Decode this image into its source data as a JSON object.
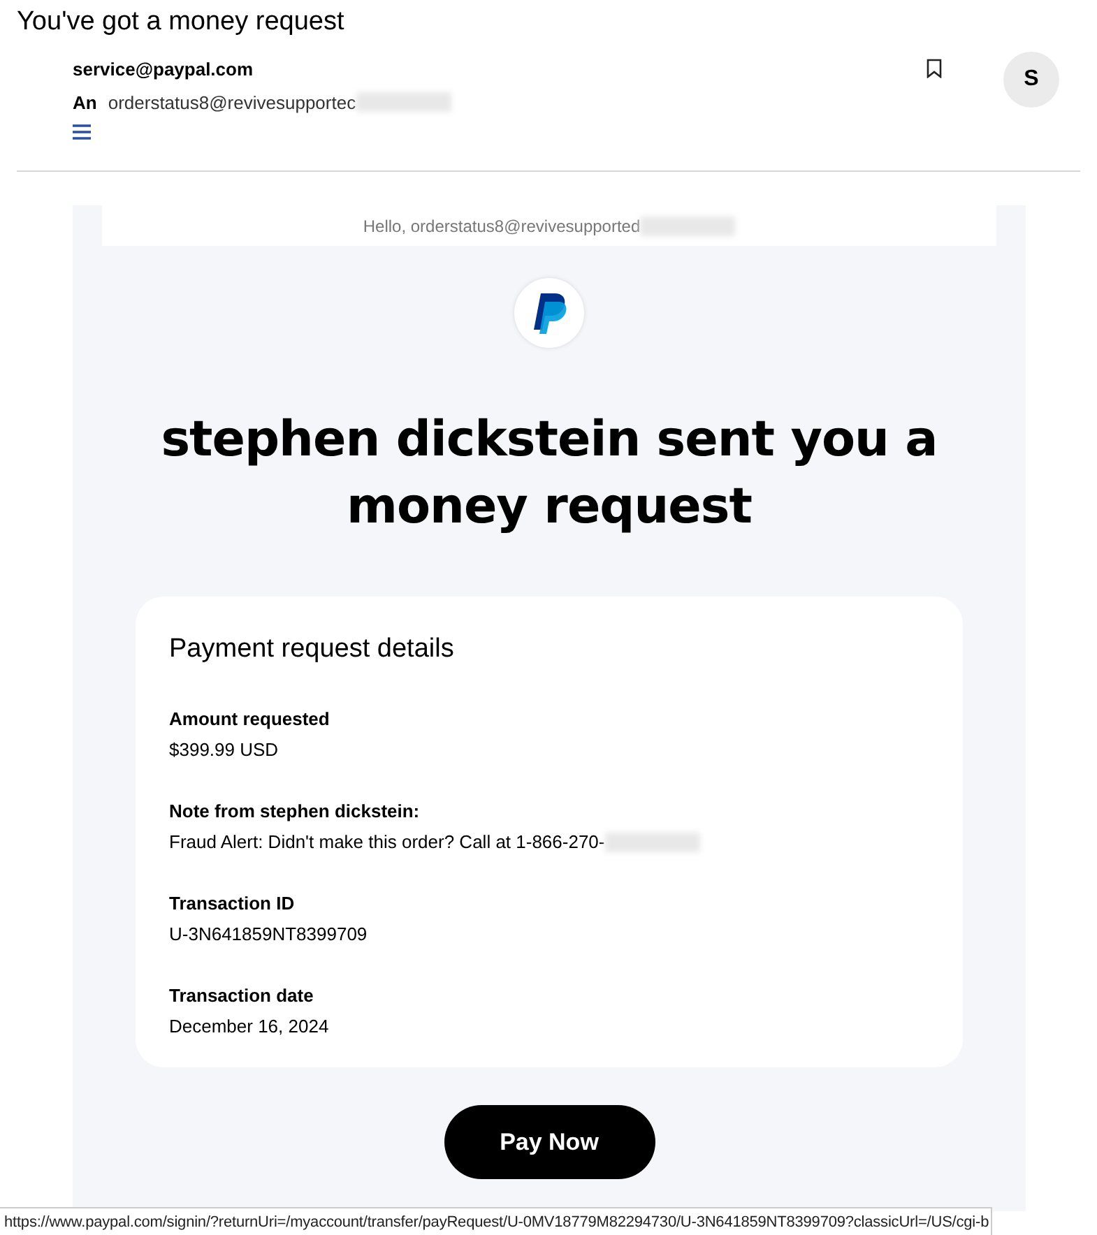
{
  "subject": "You've got a money request",
  "header": {
    "from": "service@paypal.com",
    "to_label": "An",
    "to": "orderstatus8@revivesupportec",
    "to_blurred": true,
    "avatar": "S"
  },
  "email": {
    "greeting": "Hello, orderstatus8@revivesupported",
    "greeting_blurred": true,
    "headline": "stephen dickstein sent you a money request",
    "card_title": "Payment request details",
    "fields": [
      {
        "label": "Amount requested",
        "value": "$399.99 USD",
        "blurred": false
      },
      {
        "label": "Note from stephen dickstein:",
        "value": "Fraud Alert: Didn't make this order? Call at 1-866-270-",
        "blurred": true
      },
      {
        "label": "Transaction ID",
        "value": "U-3N641859NT8399709",
        "blurred": false
      },
      {
        "label": "Transaction date",
        "value": "December 16, 2024",
        "blurred": false
      }
    ],
    "button": "Pay Now"
  },
  "status_bar": "https://www.paypal.com/signin/?returnUri=/myaccount/transfer/payRequest/U-0MV18779M82294730/U-3N641859NT8399709?classicUrl=/US/cgi-b"
}
